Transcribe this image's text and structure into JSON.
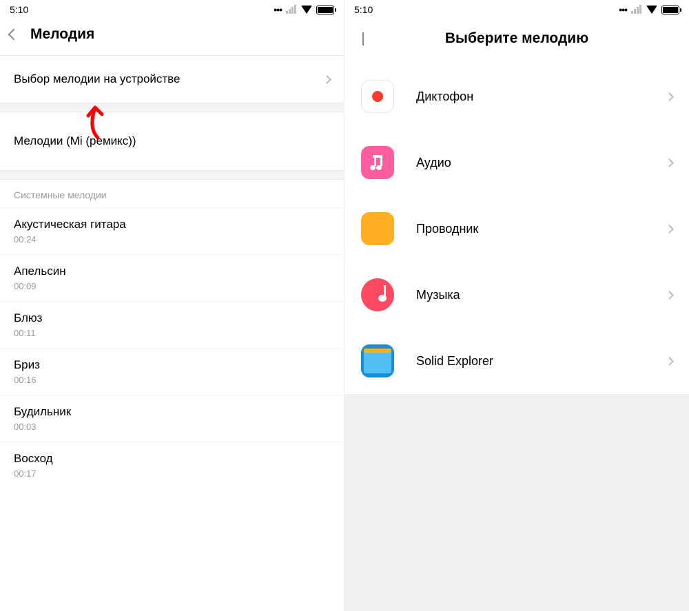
{
  "status": {
    "time": "5:10"
  },
  "left": {
    "title": "Мелодия",
    "pick_on_device": "Выбор мелодии на устройстве",
    "mi_remix": "Мелодии (Mi (ремикс))",
    "section": "Системные мелодии",
    "ringtones": [
      {
        "name": "Акустическая гитара",
        "dur": "00:24"
      },
      {
        "name": "Апельсин",
        "dur": "00:09"
      },
      {
        "name": "Блюз",
        "dur": "00:11"
      },
      {
        "name": "Бриз",
        "dur": "00:16"
      },
      {
        "name": "Будильник",
        "dur": "00:03"
      },
      {
        "name": "Восход",
        "dur": "00:17"
      }
    ]
  },
  "right": {
    "title": "Выберите мелодию",
    "apps": [
      {
        "name": "Диктофон",
        "icon": "recorder"
      },
      {
        "name": "Аудио",
        "icon": "audio"
      },
      {
        "name": "Проводник",
        "icon": "files"
      },
      {
        "name": "Музыка",
        "icon": "music"
      },
      {
        "name": "Solid Explorer",
        "icon": "solid"
      }
    ]
  }
}
